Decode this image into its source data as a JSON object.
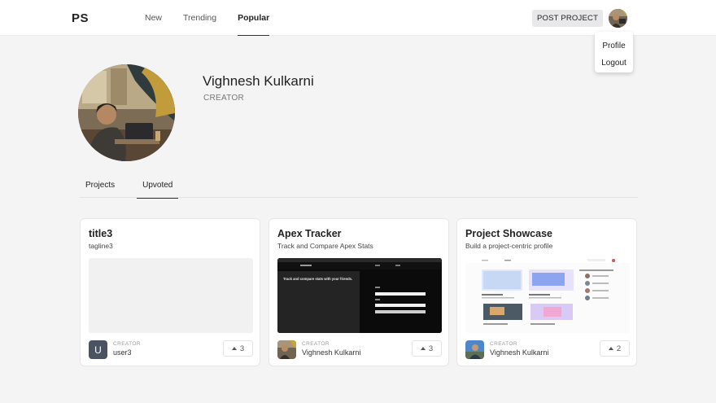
{
  "header": {
    "logo": "PS",
    "nav": [
      {
        "label": "New",
        "active": false
      },
      {
        "label": "Trending",
        "active": false
      },
      {
        "label": "Popular",
        "active": true
      }
    ],
    "post_project_label": "POST PROJECT"
  },
  "user_menu": {
    "items": [
      "Profile",
      "Logout"
    ]
  },
  "profile": {
    "name": "Vighnesh Kulkarni",
    "role": "CREATOR"
  },
  "tabs": [
    {
      "label": "Projects",
      "active": false
    },
    {
      "label": "Upvoted",
      "active": true
    }
  ],
  "cards": [
    {
      "title": "title3",
      "tagline": "tagline3",
      "creator_label": "CREATOR",
      "creator_name": "user3",
      "avatar_letter": "U",
      "upvotes": "3"
    },
    {
      "title": "Apex Tracker",
      "tagline": "Track and Compare Apex Stats",
      "creator_label": "CREATOR",
      "creator_name": "Vighnesh Kulkarni",
      "upvotes": "3",
      "preview_text": "Track and compare stats with your friends."
    },
    {
      "title": "Project Showcase",
      "tagline": "Build a project-centric profile",
      "creator_label": "CREATOR",
      "creator_name": "Vighnesh Kulkarni",
      "upvotes": "2"
    }
  ]
}
